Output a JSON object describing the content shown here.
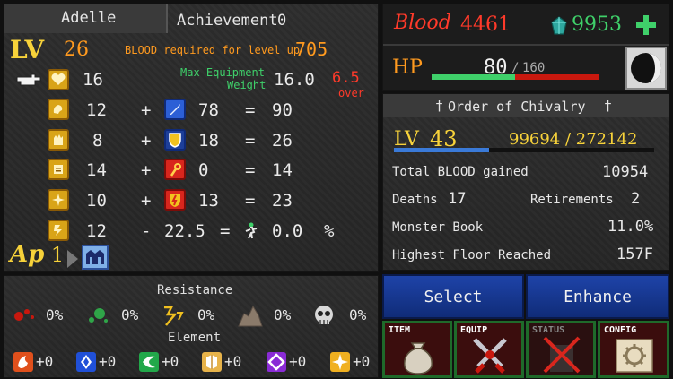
{
  "character": {
    "name": "Adelle",
    "achievement_label": "Achievement",
    "achievement_value": "0",
    "level_label": "LV",
    "level": "26",
    "blood_required_label": "BLOOD required for level up",
    "blood_required_value": "705",
    "max_equip_label_line1": "Max Equipment",
    "max_equip_label_line2": "Weight",
    "max_equip_value": "16.0",
    "over_value": "6.5",
    "over_label": "over",
    "hand_value": "16",
    "ap_label": "Ap",
    "ap_value": "1"
  },
  "stats": [
    {
      "base": "12",
      "op": "+",
      "bonus": "78",
      "eq": "=",
      "total": "90",
      "icon": "strength-icon",
      "equip_icon": "sword-icon"
    },
    {
      "base": "8",
      "op": "+",
      "bonus": "18",
      "eq": "=",
      "total": "26",
      "icon": "defense-icon",
      "equip_icon": "shield-icon"
    },
    {
      "base": "14",
      "op": "+",
      "bonus": "0",
      "eq": "=",
      "total": "14",
      "icon": "magic-icon",
      "equip_icon": "staff-icon"
    },
    {
      "base": "10",
      "op": "+",
      "bonus": "13",
      "eq": "=",
      "total": "23",
      "icon": "spirit-icon",
      "equip_icon": "ward-icon"
    },
    {
      "base": "12",
      "op": "-",
      "bonus": "22.5",
      "eq": "=",
      "total": "0.0",
      "unit": "%",
      "icon": "agility-icon",
      "equip_icon": "weight-icon"
    }
  ],
  "resistance": {
    "title": "Resistance",
    "items": [
      {
        "icon": "blood-resist-icon",
        "value": "0%"
      },
      {
        "icon": "poison-resist-icon",
        "value": "0%"
      },
      {
        "icon": "paralysis-resist-icon",
        "value": "0%"
      },
      {
        "icon": "petrify-resist-icon",
        "value": "0%"
      },
      {
        "icon": "death-resist-icon",
        "value": "0%"
      }
    ]
  },
  "element": {
    "title": "Element",
    "items": [
      {
        "icon": "fire-element-icon",
        "value": "+0",
        "color": "#e0501c"
      },
      {
        "icon": "water-element-icon",
        "value": "+0",
        "color": "#2050d8"
      },
      {
        "icon": "wind-element-icon",
        "value": "+0",
        "color": "#22a84a"
      },
      {
        "icon": "earth-element-icon",
        "value": "+0",
        "color": "#e7b34a"
      },
      {
        "icon": "dark-element-icon",
        "value": "+0",
        "color": "#8a2bd6"
      },
      {
        "icon": "light-element-icon",
        "value": "+0",
        "color": "#f0b020"
      }
    ]
  },
  "resources": {
    "blood_label": "Blood",
    "blood_value": "4461",
    "gems_value": "9953",
    "hp_label": "HP",
    "hp_current": "80",
    "hp_max": "160",
    "hp_current_fraction": 0.5
  },
  "order": {
    "title": "Order of Chivalry",
    "level_label": "LV",
    "level": "43",
    "exp_text": "99694 / 272142",
    "exp_fraction": 0.366,
    "stats": [
      {
        "label": "Total BLOOD gained",
        "value": "10954"
      },
      {
        "label": "Monster Book",
        "value": "11.0%"
      },
      {
        "label": "Highest Floor Reached",
        "value": "157F"
      }
    ],
    "deaths_label": "Deaths",
    "deaths_value": "17",
    "retirements_label": "Retirements",
    "retirements_value": "2"
  },
  "buttons": {
    "select_label": "Select",
    "enhance_label": "Enhance"
  },
  "tabs": [
    {
      "label": "ITEM",
      "icon": "money-bag-icon"
    },
    {
      "label": "EQUIP",
      "icon": "crossed-swords-icon"
    },
    {
      "label": "STATUS",
      "icon": "status-crossed-icon"
    },
    {
      "label": "CONFIG",
      "icon": "gear-scroll-icon"
    }
  ],
  "colors": {
    "accent_orange": "#ff9a1f",
    "hp_green": "#3fd06a",
    "blood_red": "#ff3a2a",
    "button_blue": "#1e43a8",
    "exp_blue": "#3a7ad8"
  }
}
